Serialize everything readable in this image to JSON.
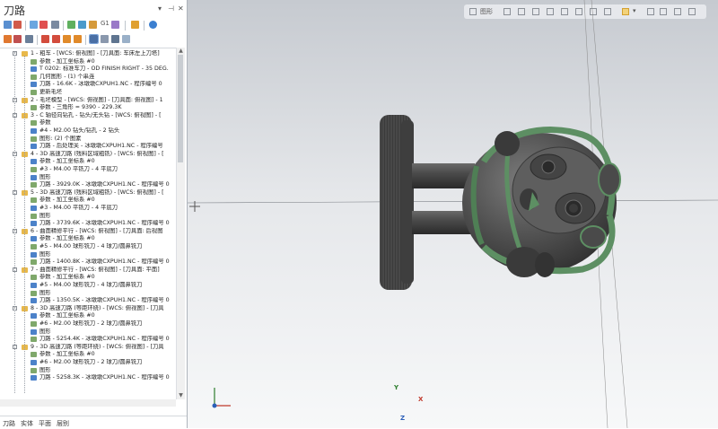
{
  "panel": {
    "title": "刀路",
    "header_pin": "▾",
    "header_close": "✕",
    "tabs": [
      "刀路",
      "实体",
      "平面",
      "层别"
    ],
    "toolbar_text_g1": "G1"
  },
  "tree": [
    {
      "text": "1 - 粗车 - [WCS: 俯视图] - [刀具面: 车床左上刀塔]"
    },
    {
      "text": "参数 - 加工坐标系 #0"
    },
    {
      "text": "T 0202: 标准车刀 - OD FINISH RIGHT - 35 DEG."
    },
    {
      "text": "几何图形 - (1) 个串连"
    },
    {
      "text": "刀路 - 16.6K - 冰墩墩CXPUH1.NC - 程序编号 0"
    },
    {
      "text": "更新毛坯"
    },
    {
      "text": "2 - 毛坯模型 - [WCS: 俯视图] - [刀具面: 俯视图] - 1"
    },
    {
      "text": "参数 - 三角形 = 9390 - 229.3K"
    },
    {
      "text": "3 - C 轴径向钻孔 - 钻头/无头钻 - [WCS: 俯视图] - ["
    },
    {
      "text": "参数"
    },
    {
      "text": "#4 - M2.00 钻头/钻孔 - 2 钻头"
    },
    {
      "text": "图形: (2) 个图素"
    },
    {
      "text": "刀路 - 后处理关 - 冰墩墩CXPUH1.NC - 程序编号"
    },
    {
      "text": "4 - 3D 高速刀路 (残料区域粗铣) - [WCS: 俯视图] - ["
    },
    {
      "text": "参数 - 加工坐标系 #0"
    },
    {
      "text": "#3 - M4.00 平铣刀 - 4 平底刀"
    },
    {
      "text": "图形"
    },
    {
      "text": "刀路 - 3929.0K - 冰墩墩CXPUH1.NC - 程序编号 0"
    },
    {
      "text": "5 - 3D 高速刀路 (残料区域粗铣) - [WCS: 俯视图] - ["
    },
    {
      "text": "参数 - 加工坐标系 #0"
    },
    {
      "text": "#3 - M4.00 平铣刀 - 4 平底刀"
    },
    {
      "text": "图形"
    },
    {
      "text": "刀路 - 3739.6K - 冰墩墩CXPUH1.NC - 程序编号 0"
    },
    {
      "text": "6 - 曲面精修平行 - [WCS: 俯视图] - [刀具面: 后视图"
    },
    {
      "text": "参数 - 加工坐标系 #0"
    },
    {
      "text": "#5 - M4.00 球形铣刀 - 4 球刀/圆鼻铣刀"
    },
    {
      "text": "图形"
    },
    {
      "text": "刀路 - 1400.8K - 冰墩墩CXPUH1.NC - 程序编号 0"
    },
    {
      "text": "7 - 曲面精修平行 - [WCS: 俯视图] - [刀具面: 平面]"
    },
    {
      "text": "参数 - 加工坐标系 #0"
    },
    {
      "text": "#5 - M4.00 球形铣刀 - 4 球刀/圆鼻铣刀"
    },
    {
      "text": "图形"
    },
    {
      "text": "刀路 - 1350.5K - 冰墩墩CXPUH1.NC - 程序编号 0"
    },
    {
      "text": "8 - 3D 高速刀路 (等距环绕) - [WCS: 俯视图] - [刀具"
    },
    {
      "text": "参数 - 加工坐标系 #0"
    },
    {
      "text": "#6 - M2.00 球形铣刀 - 2 球刀/圆鼻铣刀"
    },
    {
      "text": "图形"
    },
    {
      "text": "刀路 - 5254.4K - 冰墩墩CXPUH1.NC - 程序编号 0"
    },
    {
      "text": "9 - 3D 高速刀路 (等距环绕) - [WCS: 俯视图] - [刀具"
    },
    {
      "text": "参数 - 加工坐标系 #0"
    },
    {
      "text": "#6 - M2.00 球形铣刀 - 2 球刀/圆鼻铣刀"
    },
    {
      "text": "图形"
    },
    {
      "text": "刀路 - 5258.3K - 冰墩墩CXPUH1.NC - 程序编号 0"
    }
  ],
  "viewport": {
    "toolbar_label": "图形",
    "axis_x": "X",
    "axis_y": "Y",
    "axis_z": "Z"
  }
}
